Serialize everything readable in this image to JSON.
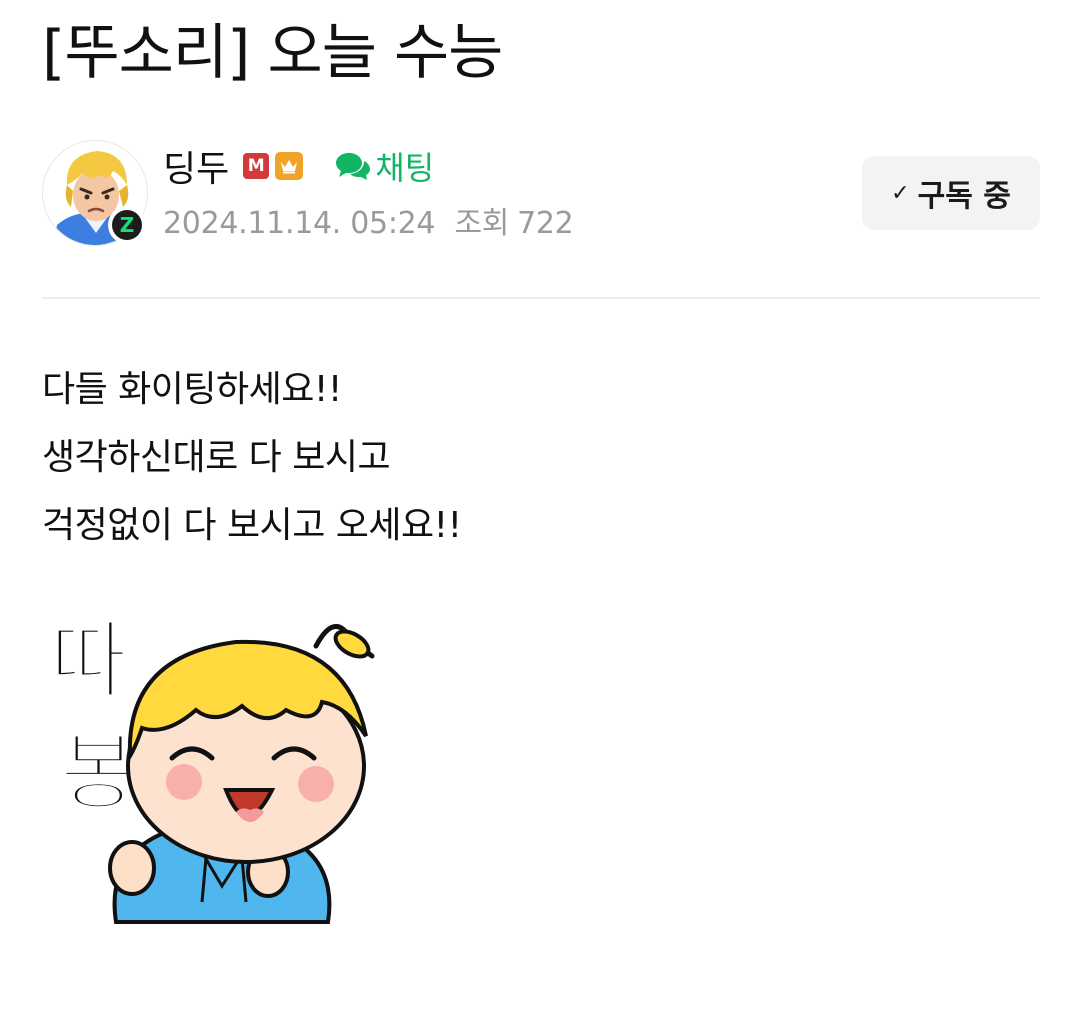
{
  "post": {
    "title": "[뚜소리] 오늘 수능",
    "author": {
      "name": "딩두",
      "badge_m": "M",
      "level_badge": "Z",
      "chat_label": "채팅"
    },
    "meta": {
      "datetime": "2024.11.14. 05:24",
      "views_label": "조회",
      "views": "722"
    },
    "subscribe": {
      "check": "✓",
      "label": "구독 중"
    },
    "body": [
      "다들 화이팅하세요!!",
      "생각하신대로 다 보시고",
      "걱정없이 다 보시고 오세요!!"
    ],
    "sticker": {
      "text_top": "따",
      "text_bottom": "봉"
    }
  },
  "colors": {
    "chat_green": "#12b563",
    "badge_red": "#d23b3b",
    "crown_orange": "#f1a328",
    "meta_gray": "#9a9a9a",
    "button_bg": "#f2f3f5"
  },
  "icons": {
    "chat": "speech-bubbles-icon",
    "crown": "crown-icon",
    "check": "checkmark-icon"
  }
}
